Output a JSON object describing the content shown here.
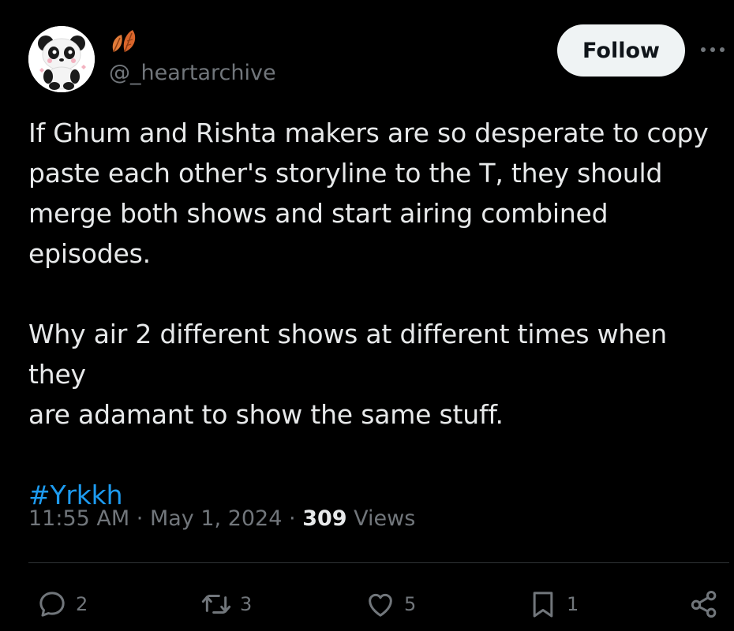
{
  "author": {
    "handle": "@_heartarchive",
    "avatar_icon": "panda-avatar",
    "name_icon": "autumn-leaves-icon"
  },
  "header": {
    "follow_label": "Follow",
    "more_icon": "more-horizontal-icon"
  },
  "tweet": {
    "paragraph1": "If Ghum and Rishta makers are so desperate to copy\npaste each other's storyline to the T, they should\nmerge both shows and start airing combined\nepisodes.",
    "paragraph2": "Why air 2 different shows at different times when they\nare adamant to show the same stuff.",
    "hashtag": "#Yrkkh"
  },
  "meta": {
    "time": "11:55 AM",
    "separator": "·",
    "date": "May 1, 2024",
    "views_count": "309",
    "views_label": "Views"
  },
  "actions": {
    "replies": "2",
    "reposts": "3",
    "likes": "5",
    "bookmarks": "1"
  },
  "colors": {
    "background": "#000000",
    "text": "#e7e9ea",
    "secondary": "#71767b",
    "accent": "#1d9bf0",
    "follow_bg": "#eff3f4"
  }
}
